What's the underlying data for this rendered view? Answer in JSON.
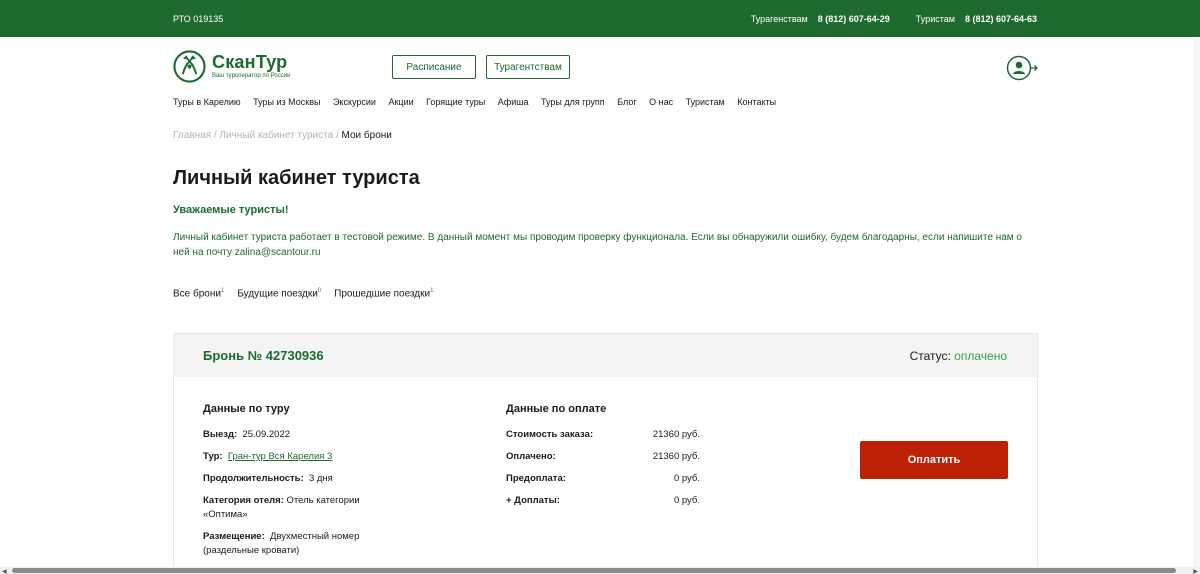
{
  "topbar": {
    "license": "РТО 019135",
    "agencies_label": "Турагенствам",
    "agencies_phone": "8 (812) 607-64-29",
    "tourists_label": "Туристам",
    "tourists_phone": "8 (812) 607-64-63"
  },
  "logo": {
    "name": "СканТур",
    "tagline": "Ваш туроператор по России"
  },
  "header": {
    "schedule_btn": "Расписание",
    "agencies_btn": "Турагентствам"
  },
  "nav": [
    "Туры в Карелию",
    "Туры из Москвы",
    "Экскурсии",
    "Акции",
    "Горящие туры",
    "Афиша",
    "Туры для групп",
    "Блог",
    "О нас",
    "Туристам",
    "Контакты"
  ],
  "breadcrumb": {
    "home": "Главная",
    "sep": " / ",
    "cabinet": "Личный кабинет туриста",
    "current": "Мои брони"
  },
  "page_title": "Личный кабинет туриста",
  "notice": {
    "title": "Уважаемые туристы!",
    "text": "Личный кабинет туриста работает в тестовой режиме. В данный момент мы проводим проверку функционала. Если вы обнаружили ошибку, будем благодарны, если напишите нам о ней на почту zalina@scantour.ru"
  },
  "tabs": [
    {
      "label": "Все брони",
      "count": "1"
    },
    {
      "label": "Будущие поездки",
      "count": "0"
    },
    {
      "label": "Прошедшие поездки",
      "count": "1"
    }
  ],
  "booking": {
    "number": "Бронь № 42730936",
    "status_label": "Статус:",
    "status_value": "оплачено",
    "tour_heading": "Данные по туру",
    "departure_label": "Выезд:",
    "departure_value": "25.09.2022",
    "tour_label": "Тур:",
    "tour_value": "Гран-тур Вся Карелия 3",
    "duration_label": "Продолжительность:",
    "duration_value": "3 дня",
    "hotel_label": "Категория отеля:",
    "hotel_value": "Отель категории «Оптима»",
    "accommodation_label": "Размещение:",
    "accommodation_value": "Двухместный номер (раздельные кровати)",
    "pay_heading": "Данные по оплате",
    "payments": [
      {
        "label": "Стоимость заказа:",
        "value": "21360 руб."
      },
      {
        "label": "Оплачено:",
        "value": "21360 руб."
      },
      {
        "label": "Предоплата:",
        "value": "0 руб."
      },
      {
        "label": "+ Доплаты:",
        "value": "0 руб."
      }
    ],
    "pay_button": "Оплатить"
  },
  "colors": {
    "brand_green": "#1f6a2e",
    "status_green": "#3aa24a",
    "pay_red": "#bd2106"
  }
}
